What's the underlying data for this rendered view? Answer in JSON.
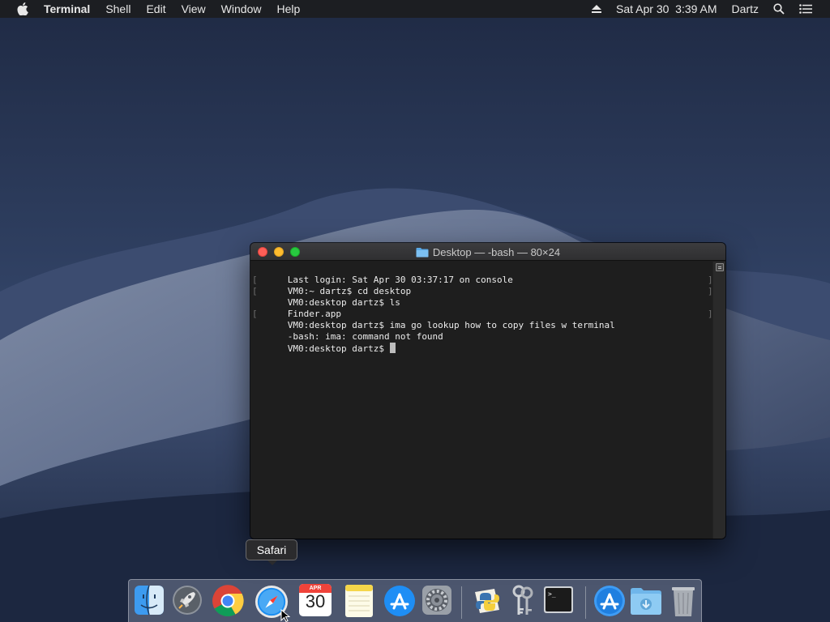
{
  "menubar": {
    "apple_icon": "apple-logo-icon",
    "app_name": "Terminal",
    "menus": [
      "Shell",
      "Edit",
      "View",
      "Window",
      "Help"
    ],
    "eject_icon": "eject-icon",
    "clock": "Sat Apr 30  3:39 AM",
    "user": "Dartz",
    "search_icon": "spotlight-search-icon",
    "notification_icon": "notification-center-icon"
  },
  "terminal": {
    "title": "Desktop — -bash — 80×24",
    "title_icon": "folder-icon",
    "lines": [
      {
        "text": "Last login: Sat Apr 30 03:37:17 on console",
        "left_mark": "",
        "right_mark": ""
      },
      {
        "text": "VM0:~ dartz$ cd desktop",
        "left_mark": "[",
        "right_mark": "]"
      },
      {
        "text": "VM0:desktop dartz$ ls",
        "left_mark": "[",
        "right_mark": "]"
      },
      {
        "text": "Finder.app",
        "left_mark": "",
        "right_mark": ""
      },
      {
        "text": "VM0:desktop dartz$ ima go lookup how to copy files w terminal",
        "left_mark": "[",
        "right_mark": "]"
      },
      {
        "text": "-bash: ima: command not found",
        "left_mark": "",
        "right_mark": ""
      },
      {
        "text": "VM0:desktop dartz$ ",
        "left_mark": "",
        "right_mark": ""
      }
    ]
  },
  "tooltip": {
    "label": "Safari"
  },
  "dock": {
    "items": [
      {
        "name": "Finder",
        "icon": "finder-icon",
        "running": false
      },
      {
        "name": "Launchpad",
        "icon": "launchpad-rocket-icon",
        "running": false
      },
      {
        "name": "Google Chrome",
        "icon": "chrome-icon",
        "running": true
      },
      {
        "name": "Safari",
        "icon": "safari-compass-icon",
        "running": false
      },
      {
        "name": "Calendar",
        "icon": "calendar-icon",
        "running": false,
        "month": "APR",
        "day": "30"
      },
      {
        "name": "Notes",
        "icon": "notes-icon",
        "running": false
      },
      {
        "name": "App Store",
        "icon": "app-store-icon",
        "running": false
      },
      {
        "name": "System Preferences",
        "icon": "system-preferences-gear-icon",
        "running": false
      },
      {
        "name": "Python Launcher",
        "icon": "python-icon",
        "running": false
      },
      {
        "name": "Keychain Access",
        "icon": "keychain-keys-icon",
        "running": false
      },
      {
        "name": "Terminal",
        "icon": "terminal-icon",
        "running": true
      },
      {
        "name": "Applications",
        "icon": "applications-folder-icon",
        "running": false
      },
      {
        "name": "Downloads",
        "icon": "downloads-folder-icon",
        "running": false
      },
      {
        "name": "Trash",
        "icon": "trash-icon",
        "running": false
      }
    ]
  },
  "colors": {
    "menubar_bg": "#1c1e22",
    "terminal_bg": "#1e1e1e",
    "close": "#fe5f57",
    "minimize": "#febc2e",
    "zoom": "#28c840"
  }
}
